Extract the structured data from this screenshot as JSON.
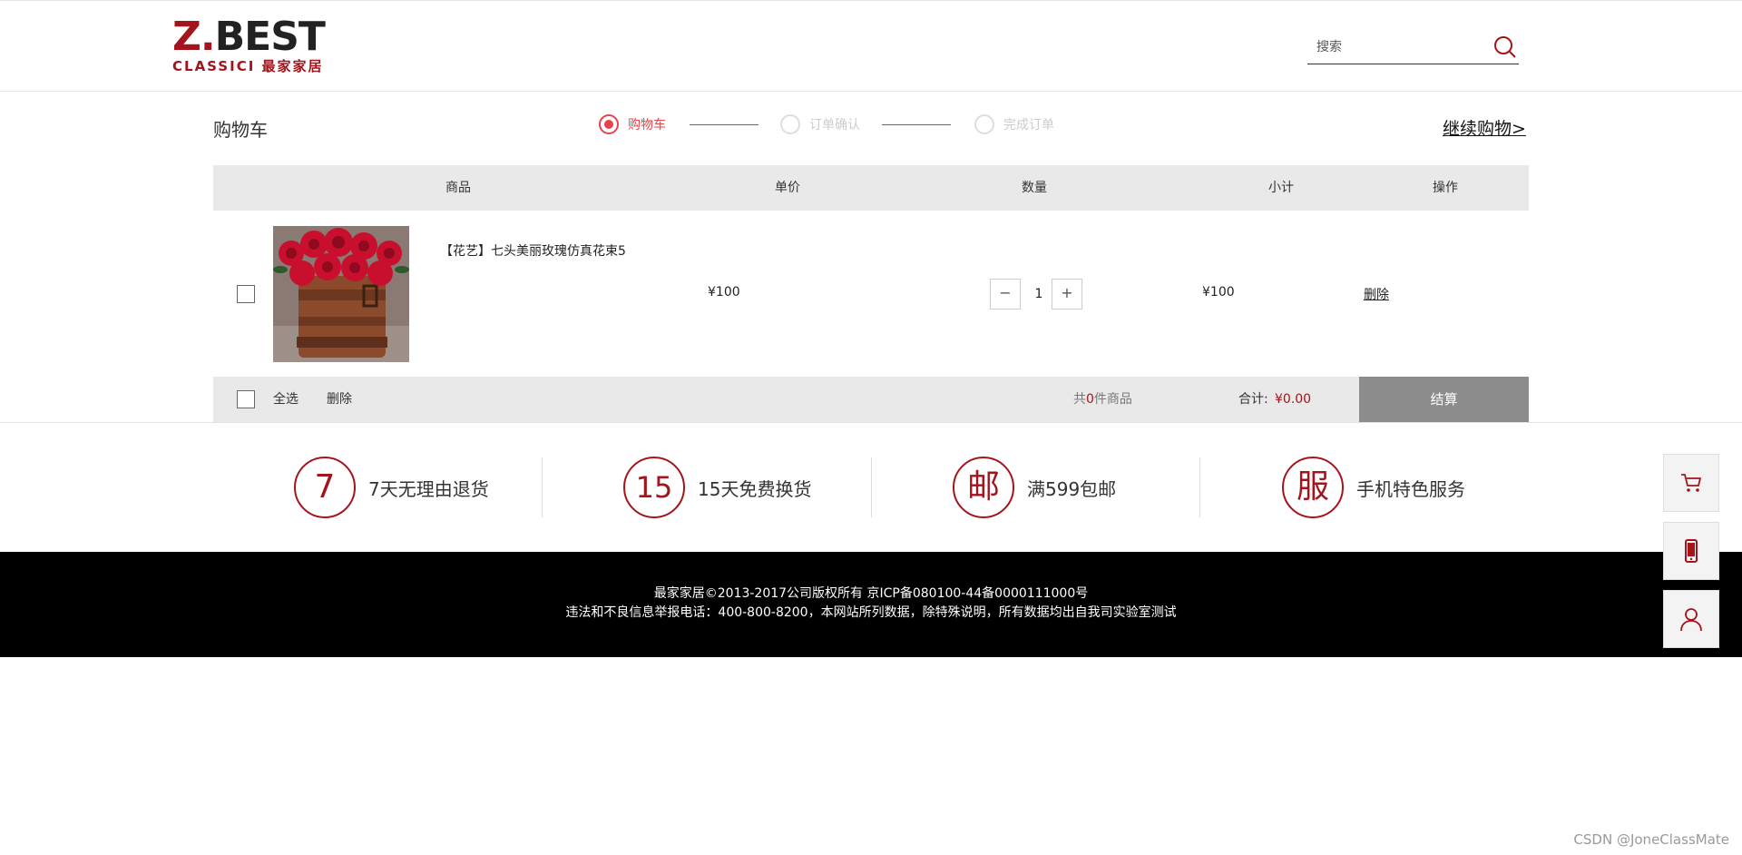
{
  "header": {
    "logo_main_left": "Z.",
    "logo_main_right": "BEST",
    "logo_sub": "CLASSICI 最家家居",
    "search_placeholder": "搜索"
  },
  "cart": {
    "title": "购物车",
    "continue_label": "继续购物>",
    "steps": [
      {
        "label": "购物车",
        "active": true
      },
      {
        "label": "订单确认",
        "active": false
      },
      {
        "label": "完成订单",
        "active": false
      }
    ],
    "columns": {
      "product": "商品",
      "unit_price": "单价",
      "quantity": "数量",
      "subtotal": "小计",
      "action": "操作"
    },
    "items": [
      {
        "name": "【花艺】七头美丽玫瑰仿真花束5",
        "price": "¥100",
        "quantity": "1",
        "subtotal": "¥100",
        "delete_label": "删除",
        "minus_label": "−",
        "plus_label": "+"
      }
    ],
    "footer": {
      "select_all": "全选",
      "delete_label": "删除",
      "count_prefix": "共",
      "count_value": "0",
      "count_suffix": "件商品",
      "total_label": "合计:",
      "total_value": "¥0.00",
      "checkout_label": "结算"
    }
  },
  "services": [
    {
      "icon_text": "7",
      "label": "7天无理由退货"
    },
    {
      "icon_text": "15",
      "label": "15天免费换货"
    },
    {
      "icon_text": "邮",
      "label": "满599包邮"
    },
    {
      "icon_text": "服",
      "label": "手机特色服务"
    }
  ],
  "footer": {
    "line1": "最家家居©2013-2017公司版权所有 京ICP备080100-44备0000111000号",
    "line2": "违法和不良信息举报电话：400-800-8200，本网站所列数据，除特殊说明，所有数据均出自我司实验室测试"
  },
  "sidebar": {
    "icons": [
      "cart-icon",
      "mobile-icon",
      "user-icon"
    ]
  },
  "watermark": "CSDN @JoneClassMate",
  "colors": {
    "brand": "#a3141c",
    "active_step": "#e8424a",
    "checkout_bg": "#8c8c8c"
  }
}
